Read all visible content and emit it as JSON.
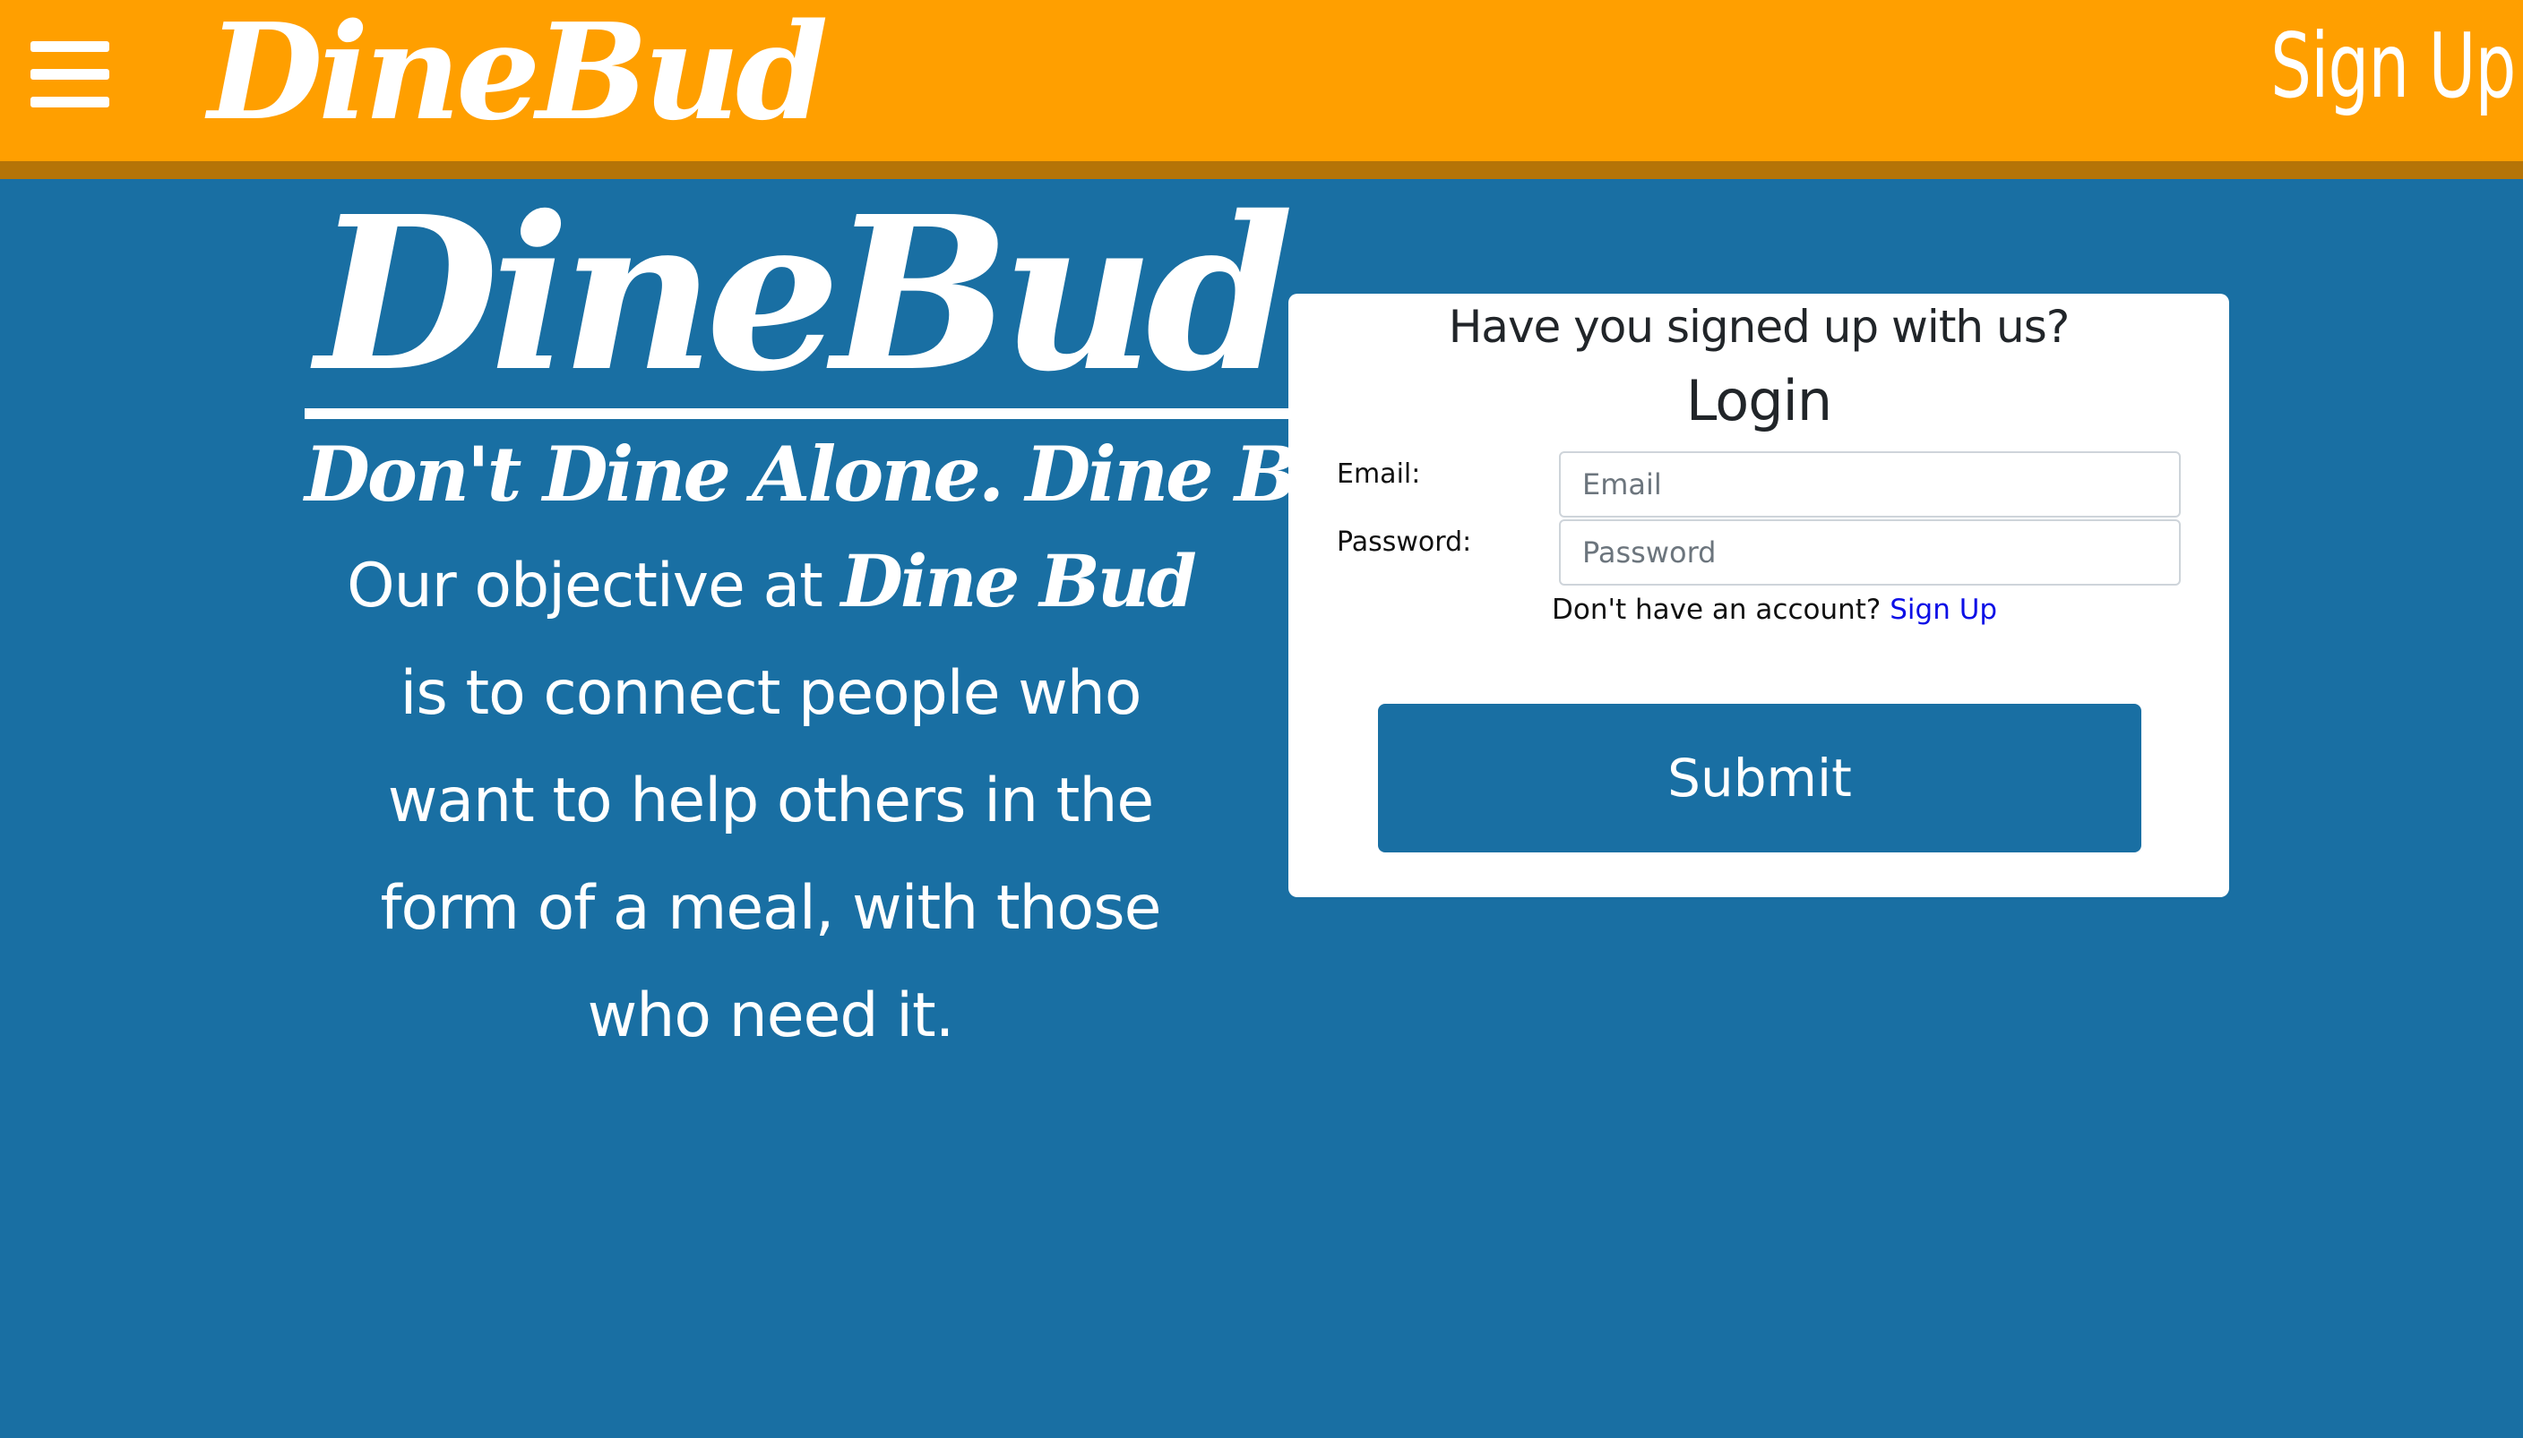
{
  "navbar": {
    "brand": "DineBud",
    "signup_label": "Sign Up",
    "menu_icon": "hamburger-menu-icon",
    "background_color": "#ff9f00",
    "border_color": "#b57407"
  },
  "hero": {
    "title": "DineBud",
    "tagline": "Don't Dine Alone. Dine Bud.",
    "description_prefix": "Our objective at",
    "description_brand": "Dine Bud",
    "description_suffix": "is to connect people who want to help others in the form of a meal, with those who need it."
  },
  "login_card": {
    "question": "Have you signed up with us?",
    "heading": "Login",
    "email_label": "Email:",
    "email_placeholder": "Email",
    "email_value": "",
    "password_label": "Password:",
    "password_placeholder": "Password",
    "password_value": "",
    "no_account_text": "Don't have an account?",
    "signup_link": "Sign Up",
    "submit_label": "Submit"
  },
  "colors": {
    "page_background": "#196fa3",
    "accent": "#ff9f00",
    "link": "#0d10e6"
  }
}
